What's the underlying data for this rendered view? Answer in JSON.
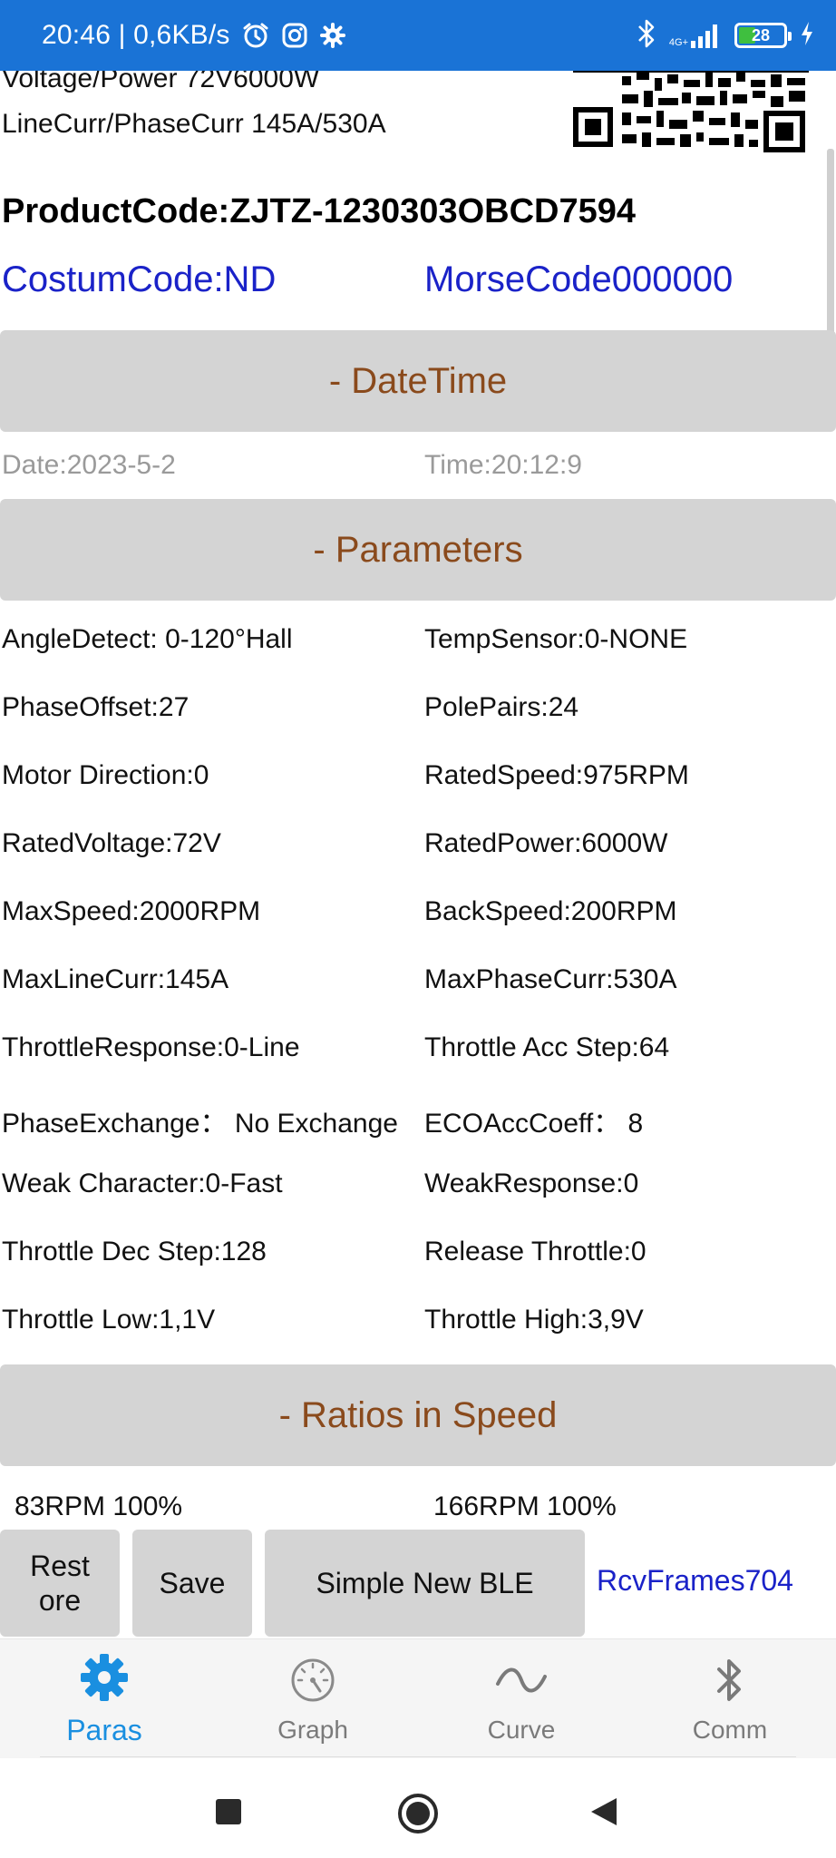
{
  "status_bar": {
    "time_speed": "20:46 | 0,6KB/s",
    "network_label": "4G+",
    "battery": "28",
    "bar_color": "#1a73d6"
  },
  "header": {
    "voltage_power": "Voltage/Power   72V6000W",
    "line_phase_curr": "LineCurr/PhaseCurr   145A/530A",
    "product_code": "ProductCode:ZJTZ-1230303OBCD7594",
    "custom_code": "CostumCode:ND",
    "morse_code": "MorseCode000000"
  },
  "sections": {
    "datetime": "- DateTime",
    "parameters": "- Parameters",
    "ratios": "- Ratios in Speed"
  },
  "datetime": {
    "date": "Date:2023-5-2",
    "time": "Time:20:12:9"
  },
  "parameters": [
    {
      "left": "AngleDetect: 0-120°Hall",
      "right": "TempSensor:0-NONE"
    },
    {
      "left": "PhaseOffset:27",
      "right": "PolePairs:24"
    },
    {
      "left": "Motor Direction:0",
      "right": "RatedSpeed:975RPM"
    },
    {
      "left": "RatedVoltage:72V",
      "right": "RatedPower:6000W"
    },
    {
      "left": "MaxSpeed:2000RPM",
      "right": "BackSpeed:200RPM"
    },
    {
      "left": "MaxLineCurr:145A",
      "right": "MaxPhaseCurr:530A"
    },
    {
      "left": "ThrottleResponse:0-Line",
      "right": "Throttle Acc Step:64"
    },
    {
      "left": "PhaseExchange： No Exchange",
      "right": "ECOAccCoeff： 8"
    },
    {
      "left": "Weak Character:0-Fast",
      "right": "WeakResponse:0"
    },
    {
      "left": "Throttle Dec Step:128",
      "right": "Release Throttle:0"
    },
    {
      "left": "Throttle Low:1,1V",
      "right": "Throttle High:3,9V"
    }
  ],
  "ratios": {
    "left": "83RPM 100%",
    "right": "166RPM 100%"
  },
  "actions": {
    "restore_line1": "Rest",
    "restore_line2": "ore",
    "save": "Save",
    "simple_new_ble": "Simple New BLE",
    "rcv_frames": "RcvFrames704"
  },
  "bottom_nav": {
    "paras": "Paras",
    "graph": "Graph",
    "curve": "Curve",
    "comm": "Comm",
    "active_color": "#1a8fe0"
  }
}
